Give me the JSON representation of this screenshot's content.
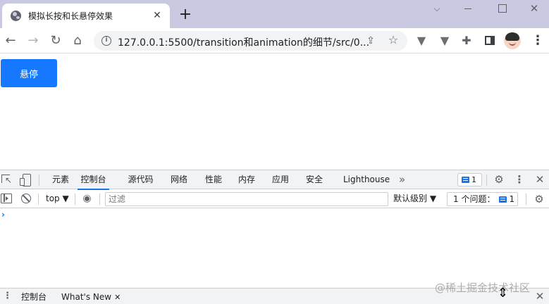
{
  "browser": {
    "tab_title": "模拟长按和长悬停效果",
    "tab_close": "✕",
    "new_tab": "+",
    "url": "127.0.0.1:5500/transition和animation的细节/src/0...",
    "icons": {
      "favicon": "globe-icon",
      "back": "arrow-left-icon",
      "forward": "arrow-right-icon",
      "reload": "reload-icon",
      "home": "home-icon",
      "info": "info-icon",
      "share": "share-icon",
      "bookmark": "star-icon",
      "extension_1": "vue-devtools-icon",
      "extension_2": "vue-devtools-icon",
      "extensions": "puzzle-icon",
      "side_panel": "side-panel-icon",
      "profile": "avatar",
      "menu": "kebab-icon"
    }
  },
  "page": {
    "button_label": "悬停",
    "button_color": "#1677ff"
  },
  "devtools": {
    "tabs": [
      {
        "label": "元素",
        "active": false
      },
      {
        "label": "控制台",
        "active": true
      },
      {
        "label": "源代码",
        "active": false
      },
      {
        "label": "网络",
        "active": false
      },
      {
        "label": "性能",
        "active": false
      },
      {
        "label": "内存",
        "active": false
      },
      {
        "label": "应用",
        "active": false
      },
      {
        "label": "安全",
        "active": false
      },
      {
        "label": "Lighthouse",
        "active": false
      }
    ],
    "more_tabs": "»",
    "issues_badge_count": "1",
    "console": {
      "context": "top ▼",
      "filter_placeholder": "过滤",
      "levels": "默认级别 ▼",
      "issues_label": "1 个问题：",
      "issues_count": "1",
      "prompt": "›"
    },
    "drawer": {
      "tabs": [
        {
          "label": "控制台"
        },
        {
          "label": "What's New"
        }
      ],
      "close": "✕"
    },
    "accent_color": "#1a73e8"
  },
  "watermark": "@稀土掘金技术社区"
}
